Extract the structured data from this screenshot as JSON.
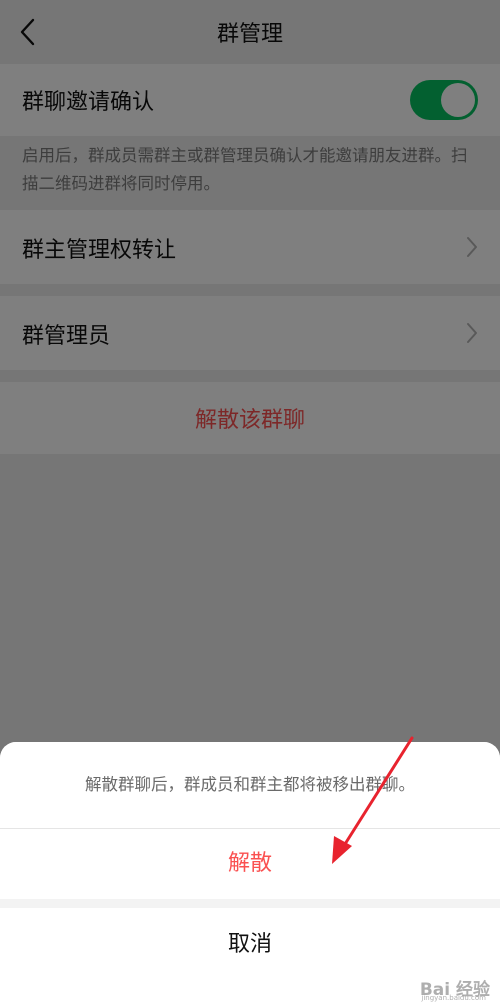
{
  "nav": {
    "title": "群管理",
    "back_icon": "back-chevron-icon"
  },
  "invite_confirm": {
    "label": "群聊邀请确认",
    "enabled": true,
    "accent": "#07c160"
  },
  "invite_desc": "启用后，群成员需群主或群管理员确认才能邀请朋友进群。扫描二维码进群将同时停用。",
  "transfer": {
    "label": "群主管理权转让",
    "icon": "chevron-right-icon"
  },
  "admins": {
    "label": "群管理员",
    "icon": "chevron-right-icon"
  },
  "dismiss": {
    "label": "解散该群聊",
    "color": "#fa5151"
  },
  "sheet": {
    "tip": "解散群聊后，群成员和群主都将被移出群聊。",
    "confirm_label": "解散",
    "cancel_label": "取消"
  },
  "watermark": {
    "text": "Bai 经验",
    "sub": "jingyan.baidu.com"
  }
}
